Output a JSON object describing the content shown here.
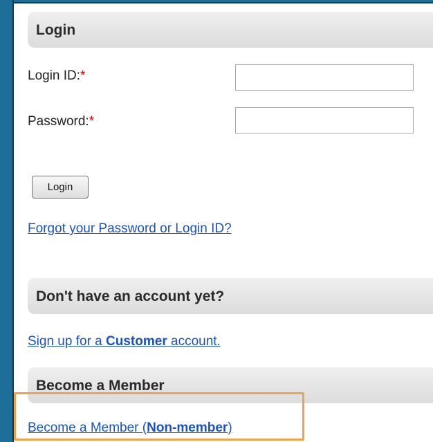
{
  "login_section": {
    "title": "Login",
    "login_id_label": "Login ID:",
    "password_label": "Password:",
    "required_marker": "*",
    "login_id_value": "",
    "password_value": "",
    "login_button": "Login",
    "forgot_link": "Forgot your Password or Login ID?"
  },
  "signup_section": {
    "title": "Don't have an account yet?",
    "link_prefix": "Sign up for a ",
    "link_bold": "Customer",
    "link_suffix": " account."
  },
  "member_section": {
    "title": "Become a Member",
    "link_prefix": "Become a Member (",
    "link_bold": "Non-member",
    "link_suffix": ")"
  },
  "colors": {
    "frame": "#1d6f99",
    "link": "#1a52c4",
    "required": "#d40000",
    "highlight": "#f0a24a"
  }
}
